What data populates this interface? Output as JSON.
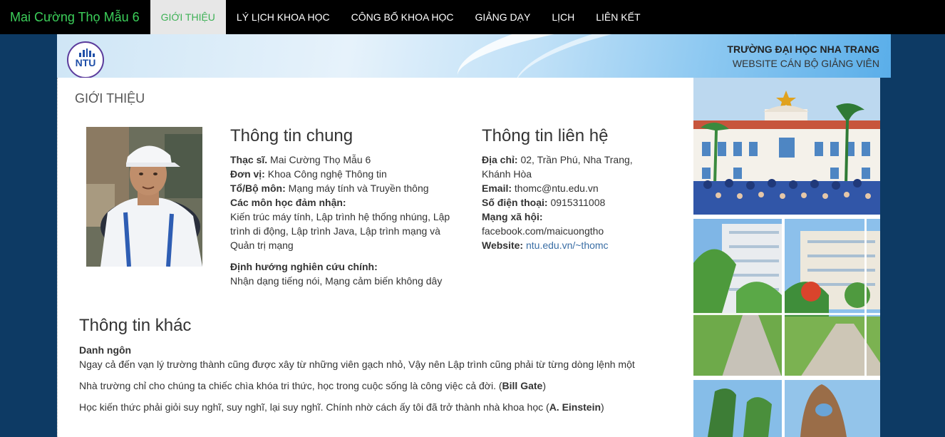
{
  "navbar": {
    "brand": "Mai Cường Thọ Mẫu 6",
    "items": [
      {
        "label": "GIỚI THIỆU",
        "active": true
      },
      {
        "label": "LÝ LỊCH KHOA HỌC",
        "active": false
      },
      {
        "label": "CÔNG BỐ KHOA HỌC",
        "active": false
      },
      {
        "label": "GIẢNG DẠY",
        "active": false
      },
      {
        "label": "LỊCH",
        "active": false
      },
      {
        "label": "LIÊN KẾT",
        "active": false
      }
    ]
  },
  "header": {
    "logo_text": "NTU",
    "university": "TRƯỜNG ĐẠI HỌC NHA TRANG",
    "subtitle": "WEBSITE CÁN BỘ GIẢNG VIÊN"
  },
  "page_title": "GIỚI THIỆU",
  "general": {
    "heading": "Thông tin chung",
    "degree_label": "Thạc sĩ.",
    "name": "Mai Cường Thọ Mẫu 6",
    "unit_label": "Đơn vị:",
    "unit": "Khoa Công nghệ Thông tin",
    "dept_label": "Tổ/Bộ môn:",
    "dept": "Mạng máy tính và Truyền thông",
    "courses_label": "Các môn học đảm nhận:",
    "courses": "Kiến trúc máy tính, Lập trình hệ thống nhúng, Lập trình di động, Lập trình Java, Lập trình mạng và Quản trị mạng",
    "research_label": "Định hướng nghiên cứu chính:",
    "research": "Nhận dạng tiếng nói, Mạng cảm biến không dây"
  },
  "contact": {
    "heading": "Thông tin liên hệ",
    "address_label": "Địa chỉ:",
    "address": "02, Trần Phú, Nha Trang, Khánh Hòa",
    "email_label": "Email:",
    "email": "thomc@ntu.edu.vn",
    "phone_label": "Số điện thoại:",
    "phone": "0915311008",
    "social_label": "Mạng xã hội:",
    "social": "facebook.com/maicuongtho",
    "website_label": "Website:",
    "website": "ntu.edu.vn/~thomc"
  },
  "other": {
    "heading": "Thông tin khác",
    "quote_label": "Danh ngôn",
    "quote1": "Ngay cả đến vạn lý trường thành cũng được xây từ những viên gạch nhỏ, Vậy nên Lập trình cũng phải từ từng dòng lệnh một",
    "quote2_text": "Nhà trường chỉ cho chúng ta chiếc chìa khóa tri thức, học trong cuộc sống là công việc cả đời. (",
    "quote2_author": "Bill Gate",
    "quote3_text": " Học kiến thức phải giỏi suy nghĩ, suy nghĩ, lại suy nghĩ. Chính nhờ cách ấy tôi đã trở thành nhà khoa học (",
    "quote3_author": "A. Einstein",
    "close_paren": ")"
  },
  "colors": {
    "nav_bg": "#000000",
    "brand": "#3ccf5a",
    "active_tab_bg": "#e7e7e7",
    "page_bg": "#0d3a64",
    "link": "#3a6ea5"
  }
}
